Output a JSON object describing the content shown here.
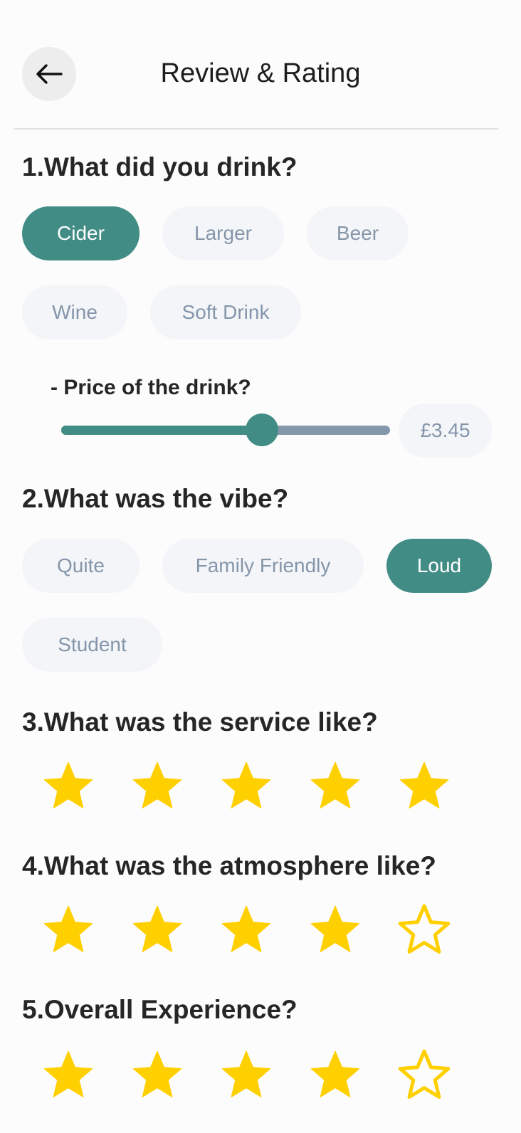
{
  "header": {
    "title": "Review & Rating",
    "back_icon": "arrow-left-icon"
  },
  "q1": {
    "title": "1.What did you drink?",
    "options": [
      "Cider",
      "Larger",
      "Beer",
      "Wine",
      "Soft Drink"
    ],
    "selected": "Cider"
  },
  "price": {
    "label": "- Price of the drink?",
    "value": "£3.45",
    "slider_fraction": 0.61
  },
  "q2": {
    "title": "2.What was the vibe?",
    "options": [
      "Quite",
      "Family Friendly",
      "Loud",
      "Student"
    ],
    "selected": "Loud"
  },
  "q3": {
    "title": "3.What was the service like?",
    "rating": 5,
    "max": 5
  },
  "q4": {
    "title": "4.What was the atmosphere like?",
    "rating": 4,
    "max": 5
  },
  "q5": {
    "title": "5.Overall Experience?",
    "rating": 4,
    "max": 5
  },
  "colors": {
    "accent": "#418c85",
    "chip_bg": "#f3f5f8",
    "chip_text": "#8596aa",
    "star": "#ffd000"
  }
}
